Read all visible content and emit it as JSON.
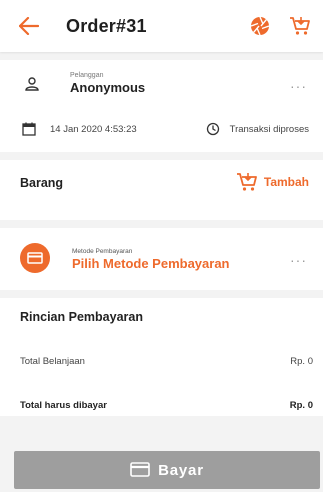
{
  "header": {
    "title": "Order#31",
    "back_icon": "arrow-left-icon",
    "action_icon": "aperture-icon",
    "cart_icon": "cart-icon"
  },
  "customer": {
    "label": "Pelanggan",
    "name": "Anonymous",
    "more": "···",
    "date": "14 Jan 2020 4:53:23",
    "status": "Transaksi diproses"
  },
  "items": {
    "title": "Barang",
    "add_label": "Tambah"
  },
  "payment_method": {
    "label": "Metode Pembayaran",
    "value": "Pilih Metode Pembayaran",
    "more": "···"
  },
  "payment_details": {
    "title": "Rincian Pembayaran",
    "rows": [
      {
        "label": "Total Belanjaan",
        "value": "Rp. 0"
      },
      {
        "label": "Total harus dibayar",
        "value": "Rp. 0"
      }
    ]
  },
  "footer": {
    "pay_label": "Bayar"
  },
  "colors": {
    "accent": "#ee6a2c",
    "disabled_button": "#9e9e9e"
  }
}
